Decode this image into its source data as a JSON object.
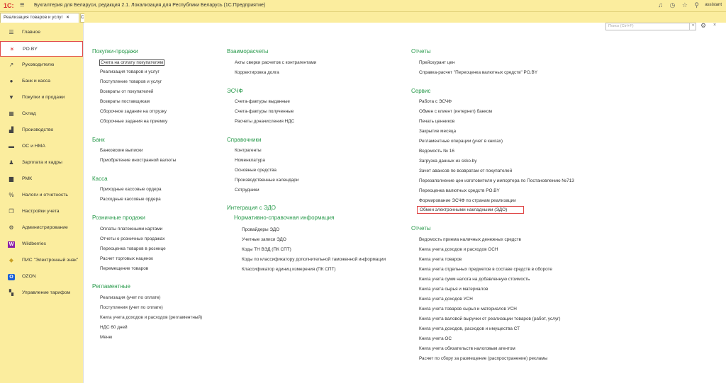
{
  "titlebar": {
    "logo": "1С:",
    "title": "Бухгалтерия для Беларуси, редакция 2.1. Локализация для Республики Беларусь   (1С:Предприятие)",
    "user": "assistant"
  },
  "tabs": [
    {
      "label": "Реализация товаров и услуг",
      "close": "×"
    }
  ],
  "tab2_label": "С",
  "sidebar": {
    "items": [
      {
        "label": "Главное",
        "icon": "list-icon",
        "glyph": "☰"
      },
      {
        "label": "PO.BY",
        "icon": "sun-icon",
        "glyph": "☀"
      },
      {
        "label": "Руководителю",
        "icon": "trend-icon",
        "glyph": "↗"
      },
      {
        "label": "Банк и касса",
        "icon": "coin-icon",
        "glyph": "●"
      },
      {
        "label": "Покупки и продажи",
        "icon": "cart-icon",
        "glyph": "▼"
      },
      {
        "label": "Склад",
        "icon": "grid-icon",
        "glyph": "▦"
      },
      {
        "label": "Производство",
        "icon": "factory-icon",
        "glyph": "▟"
      },
      {
        "label": "ОС и НМА",
        "icon": "truck-icon",
        "glyph": "▬"
      },
      {
        "label": "Зарплата и кадры",
        "icon": "person-icon",
        "glyph": "♟"
      },
      {
        "label": "РМК",
        "icon": "register-icon",
        "glyph": "▆"
      },
      {
        "label": "Налоги и отчетность",
        "icon": "percent-icon",
        "glyph": "%"
      },
      {
        "label": "Настройки учета",
        "icon": "docs-icon",
        "glyph": "❐"
      },
      {
        "label": "Администрирование",
        "icon": "gear-icon",
        "glyph": "⚙"
      },
      {
        "label": "Wildberries",
        "icon": "wb-icon",
        "glyph": "W"
      },
      {
        "label": "ПИС \"Электронный знак\"",
        "icon": "diamond-icon",
        "glyph": "◆"
      },
      {
        "label": "OZON",
        "icon": "ozon-icon",
        "glyph": "O"
      },
      {
        "label": "Управление тарифом",
        "icon": "tiles-icon",
        "glyph": "▚"
      }
    ]
  },
  "search": {
    "placeholder": "Поиск (Ctrl+F)"
  },
  "col1": {
    "s1": {
      "title": "Покупки-продажи",
      "links": [
        "Счета на оплату покупателям",
        "Реализация товаров и услуг",
        "Поступление товаров и услуг",
        "Возвраты от покупателей",
        "Возвраты поставщикам",
        "Сборочное задание на отгрузку",
        "Сборочные задания на приемку"
      ]
    },
    "s2": {
      "title": "Банк",
      "links": [
        "Банковские выписки",
        "Приобретение иностранной валюты"
      ]
    },
    "s3": {
      "title": "Касса",
      "links": [
        "Приходные кассовые ордера",
        "Расходные кассовые ордера"
      ]
    },
    "s4": {
      "title": "Розничные продажи",
      "links": [
        "Оплаты платежными картами",
        "Отчеты о розничных продажах",
        "Переоценка товаров в рознице",
        "Расчет торговых наценок",
        "Перемещение товаров"
      ]
    },
    "s5": {
      "title": "Регламентные",
      "links": [
        "Реализация (учет по оплате)",
        "Поступления (учет по оплате)",
        "Книга учета доходов и расходов (регламентный)",
        "НДС 60 дней",
        "Меню"
      ]
    }
  },
  "col2": {
    "s1": {
      "title": "Взаиморасчеты",
      "links": [
        "Акты сверки расчетов с контрагентами",
        "Корректировка долга"
      ]
    },
    "s2": {
      "title": "ЭСЧФ",
      "links": [
        "Счета-фактуры выданные",
        "Счета-фактуры полученные",
        "Расчеты доначисления НДС"
      ]
    },
    "s3": {
      "title": "Справочники",
      "links": [
        "Контрагенты",
        "Номенклатура",
        "Основные средства",
        "Производственные календари",
        "Сотрудники"
      ]
    },
    "s4": {
      "title": "Интеграция с ЭДО",
      "subtitle": "Нормативно-справочная информация",
      "links": [
        "Провайдеры ЭДО",
        "Учетные записи ЭДО",
        "Коды ТН ВЭД  (ПК СПТ)",
        "Коды по классификатору дополнительной таможенной информации",
        "Классификатор единиц измерения (ПК СПТ)"
      ]
    }
  },
  "col3": {
    "s1": {
      "title": "Отчеты",
      "links": [
        "Прейскурант цен",
        "Справка-расчет \"Переоценка валютных средств\" PO.BY"
      ]
    },
    "s2": {
      "title": "Сервис",
      "links": [
        "Работа с ЭСЧФ",
        "Обмен с клиент (интернет) банком",
        "Печать ценников",
        "Закрытие месяца",
        "Регламентные операции (учет в книгах)",
        "Ведомость № 16",
        "Загрузка данных из skko.by",
        "Зачет авансов по возвратам от покупателей",
        "Перезаполнение цен изготовителя у импортера по Постановлению №713",
        "Переоценка валютных средств PO.BY",
        "Формирование ЭСЧФ по странам реализации",
        "Обмен электронными накладными (ЭДО)"
      ]
    },
    "s3": {
      "title": "Отчеты",
      "links": [
        "Ведомость приема наличных денежных средств",
        "Книга учета доходов и расходов ОСН",
        "Книга учета товаров",
        "Книга учета отдельных предметов в составе средств в обороте",
        "Книга учета сумм налога на добавленную стоимость",
        "Книга учета сырья и материалов",
        "Книга учета доходов УСН",
        "Книга учета товаров сырья и материалов УСН",
        "Книга учета валовой выручки от реализации товаров (работ, услуг)",
        "Книга учета доходов, расходов и имущества СТ",
        "Книга учета ОС",
        "Книга учета обязательств налоговым агентом",
        "Расчет по сбору за размещение (распространение) рекламы"
      ]
    }
  }
}
